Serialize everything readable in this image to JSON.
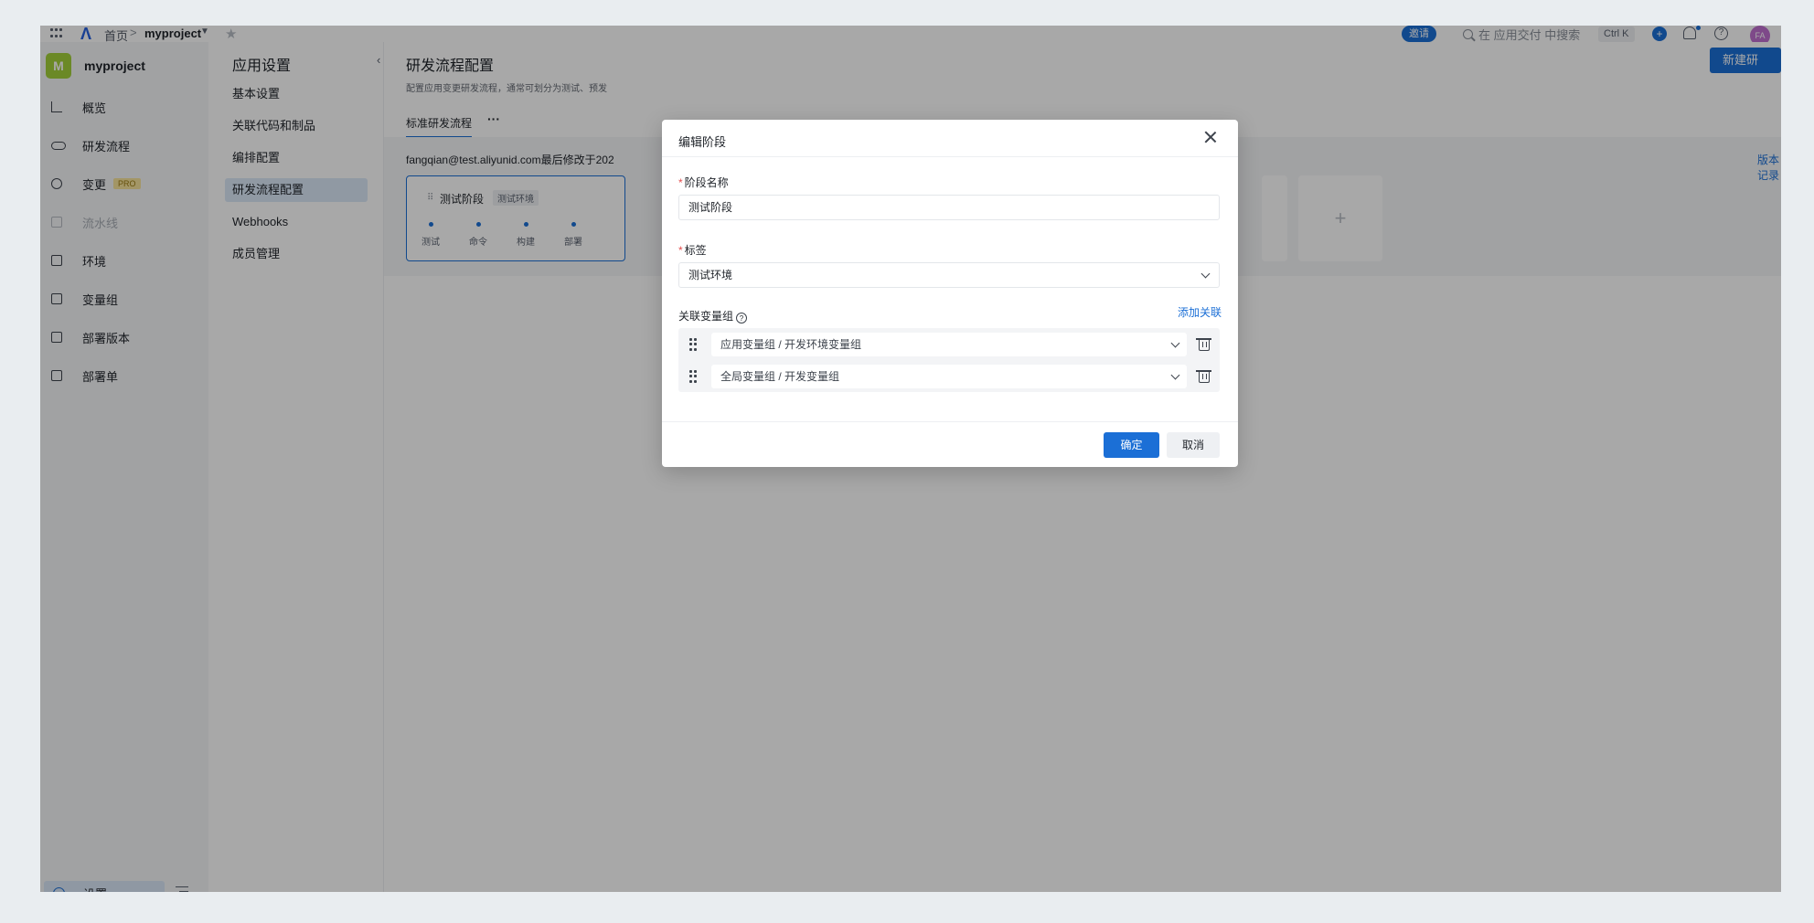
{
  "topbar": {
    "home": "首页",
    "separator": ">",
    "project": "myproject",
    "invite": "邀请",
    "search_placeholder": "在 应用交付 中搜索",
    "shortcut": "Ctrl K",
    "avatar_initials": "FA"
  },
  "leftnav": {
    "project_badge": "M",
    "project_name": "myproject",
    "items": [
      {
        "label": "概览",
        "icon": "chart-icon"
      },
      {
        "label": "研发流程",
        "icon": "infinity-icon"
      },
      {
        "label": "变更",
        "icon": "change-icon",
        "badge": "PRO"
      },
      {
        "label": "流水线",
        "icon": "pipeline-icon",
        "disabled": true
      },
      {
        "label": "环境",
        "icon": "environment-icon"
      },
      {
        "label": "变量组",
        "icon": "variable-group-icon"
      },
      {
        "label": "部署版本",
        "icon": "deploy-version-icon"
      },
      {
        "label": "部署单",
        "icon": "deploy-order-icon"
      }
    ],
    "settings": "设置"
  },
  "settings_col": {
    "title": "应用设置",
    "collapse": "‹",
    "items": [
      "基本设置",
      "关联代码和制品",
      "编排配置",
      "研发流程配置",
      "Webhooks",
      "成员管理"
    ],
    "active_index": 3
  },
  "main": {
    "title": "研发流程配置",
    "description": "配置应用变更研发流程，通常可划分为测试、预发",
    "new_button": "新建研发流程",
    "tab": "标准研发流程",
    "tab_more": "···",
    "modifier": "fangqian@test.aliyunid.com最后修改于202",
    "version_link": "版本记录",
    "stage": {
      "name": "测试阶段",
      "tag": "测试环境",
      "steps": [
        "测试",
        "命令",
        "构建",
        "部署"
      ]
    },
    "add_stage": "+"
  },
  "modal": {
    "title": "编辑阶段",
    "stage_name_label": "阶段名称",
    "stage_name_value": "测试阶段",
    "tag_label": "标签",
    "tag_value": "测试环境",
    "var_group_label": "关联变量组",
    "help": "?",
    "add_link": "添加关联",
    "var_groups": [
      "应用变量组 / 开发环境变量组",
      "全局变量组 / 开发变量组"
    ],
    "ok": "确定",
    "cancel": "取消"
  },
  "colors": {
    "accent": "#1b6fd6",
    "project_badge": "#a3d13b",
    "avatar": "#c070d0",
    "pro_badge": "#f7e49c"
  }
}
